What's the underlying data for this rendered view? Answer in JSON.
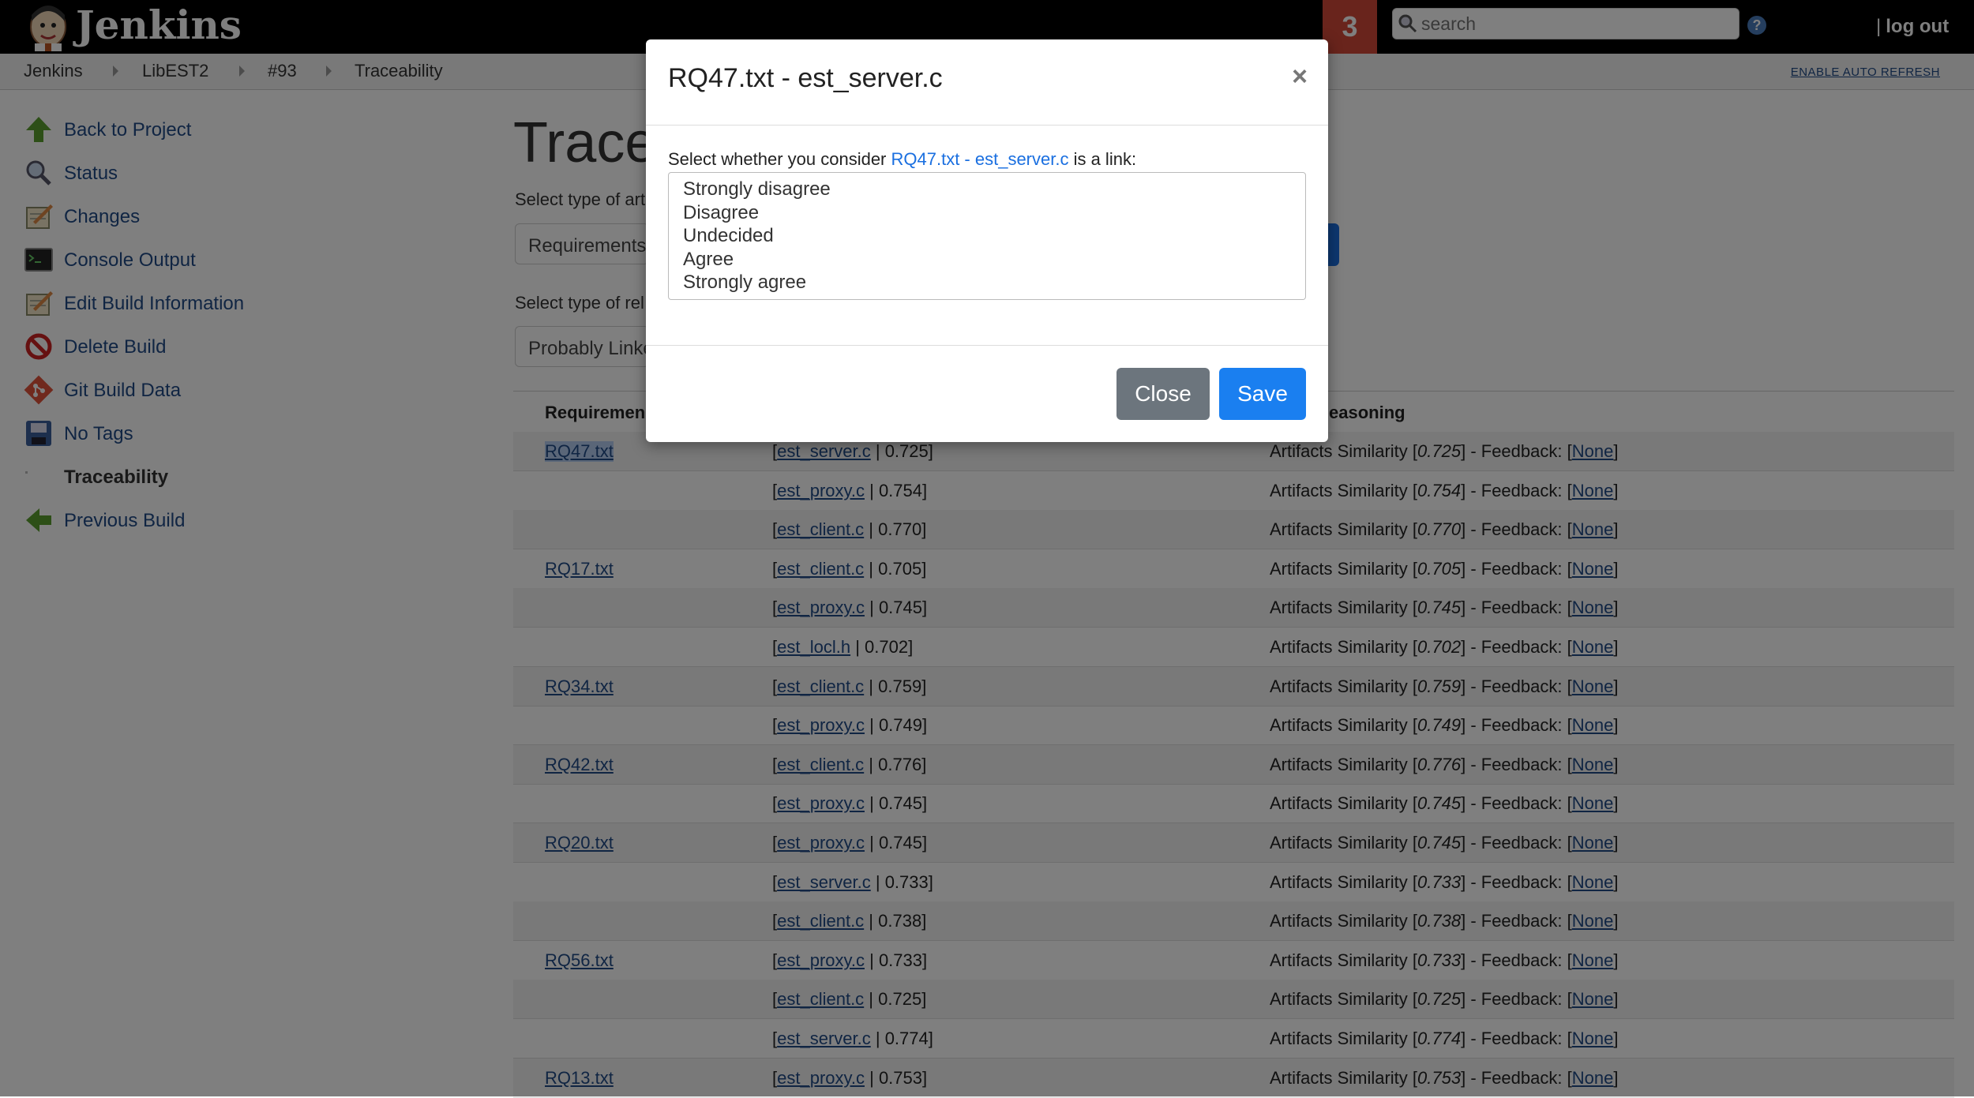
{
  "header": {
    "brand": "Jenkins",
    "badge_count": "3",
    "search_placeholder": "search",
    "help": "?",
    "logout_label": "log out"
  },
  "breadcrumbs": [
    "Jenkins",
    "LibEST2",
    "#93",
    "Traceability"
  ],
  "auto_refresh_label": "ENABLE AUTO REFRESH",
  "sidebar": {
    "items": [
      {
        "label": "Back to Project",
        "icon": "up-arrow-icon"
      },
      {
        "label": "Status",
        "icon": "magnifier-icon"
      },
      {
        "label": "Changes",
        "icon": "notepad-icon"
      },
      {
        "label": "Console Output",
        "icon": "terminal-icon"
      },
      {
        "label": "Edit Build Information",
        "icon": "notepad-icon"
      },
      {
        "label": "Delete Build",
        "icon": "no-entry-icon"
      },
      {
        "label": "Git Build Data",
        "icon": "git-icon"
      },
      {
        "label": "No Tags",
        "icon": "save-icon"
      },
      {
        "label": "Traceability",
        "icon": "blank-icon"
      },
      {
        "label": "Previous Build",
        "icon": "left-arrow-icon"
      }
    ]
  },
  "main": {
    "title": "Trace",
    "artifact_type_label": "Select type of art",
    "artifact_type_value": "Requirements",
    "relation_type_label": "Select type of rel",
    "relation_type_value": "Probably Linke",
    "columns": {
      "requirement": "Requiremen",
      "reasoning": "easoning"
    },
    "rows": [
      {
        "req": "RQ47.txt",
        "art": "est_server.c",
        "score": "0.725"
      },
      {
        "req": "",
        "art": "est_proxy.c",
        "score": "0.754"
      },
      {
        "req": "",
        "art": "est_client.c",
        "score": "0.770"
      },
      {
        "req": "RQ17.txt",
        "art": "est_client.c",
        "score": "0.705"
      },
      {
        "req": "",
        "art": "est_proxy.c",
        "score": "0.745"
      },
      {
        "req": "",
        "art": "est_locl.h",
        "score": "0.702"
      },
      {
        "req": "RQ34.txt",
        "art": "est_client.c",
        "score": "0.759"
      },
      {
        "req": "",
        "art": "est_proxy.c",
        "score": "0.749"
      },
      {
        "req": "RQ42.txt",
        "art": "est_client.c",
        "score": "0.776"
      },
      {
        "req": "",
        "art": "est_proxy.c",
        "score": "0.745"
      },
      {
        "req": "RQ20.txt",
        "art": "est_proxy.c",
        "score": "0.745"
      },
      {
        "req": "",
        "art": "est_server.c",
        "score": "0.733"
      },
      {
        "req": "",
        "art": "est_client.c",
        "score": "0.738"
      },
      {
        "req": "RQ56.txt",
        "art": "est_proxy.c",
        "score": "0.733"
      },
      {
        "req": "",
        "art": "est_client.c",
        "score": "0.725"
      },
      {
        "req": "",
        "art": "est_server.c",
        "score": "0.774"
      },
      {
        "req": "RQ13.txt",
        "art": "est_proxy.c",
        "score": "0.753"
      }
    ],
    "reasoning_prefix": "Artifacts Similarity [",
    "reasoning_mid": "] - Feedback: [",
    "feedback_link": "None",
    "reasoning_suffix": "]"
  },
  "modal": {
    "title": "RQ47.txt - est_server.c",
    "close_glyph": "×",
    "prompt_before": "Select whether you consider ",
    "prompt_link": "RQ47.txt - est_server.c",
    "prompt_after": " is a link:",
    "options": [
      "Strongly disagree",
      "Disagree",
      "Undecided",
      "Agree",
      "Strongly agree"
    ],
    "close_label": "Close",
    "save_label": "Save"
  },
  "colors": {
    "header_bg": "#000000",
    "badge_bg": "#d24939",
    "link": "#204a87",
    "primary_button": "#1a7ff0",
    "secondary_button": "#6c757d"
  }
}
